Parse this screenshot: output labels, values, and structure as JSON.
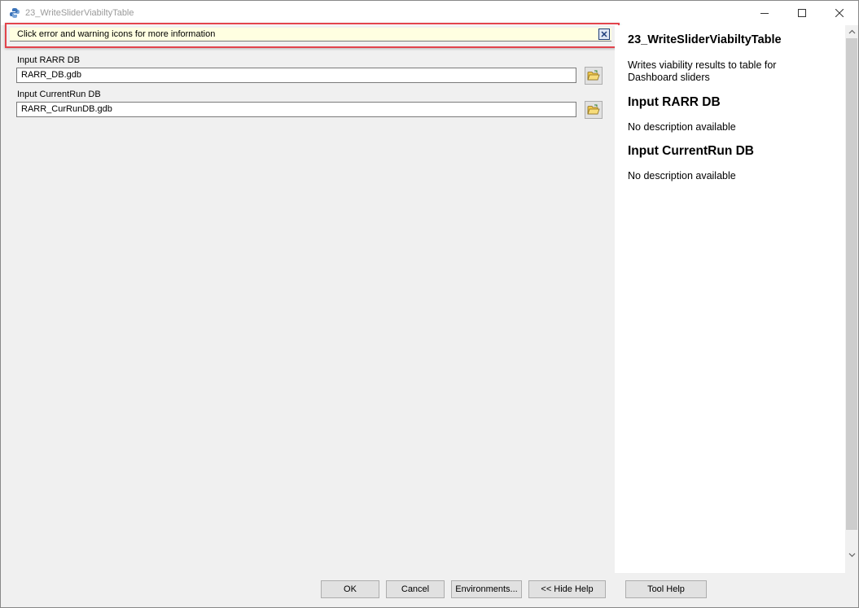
{
  "window": {
    "title": "23_WriteSliderViabiltyTable",
    "controls": {
      "minimize_icon": "minimize-icon",
      "maximize_icon": "maximize-icon",
      "close_icon": "close-icon"
    }
  },
  "warning": {
    "message": "Click error and warning icons for more information",
    "close_icon": "close-x-icon"
  },
  "params": [
    {
      "label": "Input RARR DB",
      "value": "RARR_DB.gdb",
      "icon": "open-folder-icon"
    },
    {
      "label": "Input CurrentRun DB",
      "value": "RARR_CurRunDB.gdb",
      "icon": "open-folder-icon"
    }
  ],
  "help": {
    "title": "23_WriteSliderViabiltyTable",
    "description": "Writes viability results to table for Dashboard sliders",
    "sections": [
      {
        "heading": "Input RARR DB",
        "text": "No description available"
      },
      {
        "heading": "Input CurrentRun DB",
        "text": "No description available"
      }
    ]
  },
  "buttons": {
    "ok": "OK",
    "cancel": "Cancel",
    "environments": "Environments...",
    "hide_help": "<< Hide Help",
    "tool_help": "Tool Help"
  },
  "colors": {
    "warning_bg": "#ffffe1",
    "highlight_border": "#e2444c",
    "folder_yellow": "#f2c94c"
  }
}
